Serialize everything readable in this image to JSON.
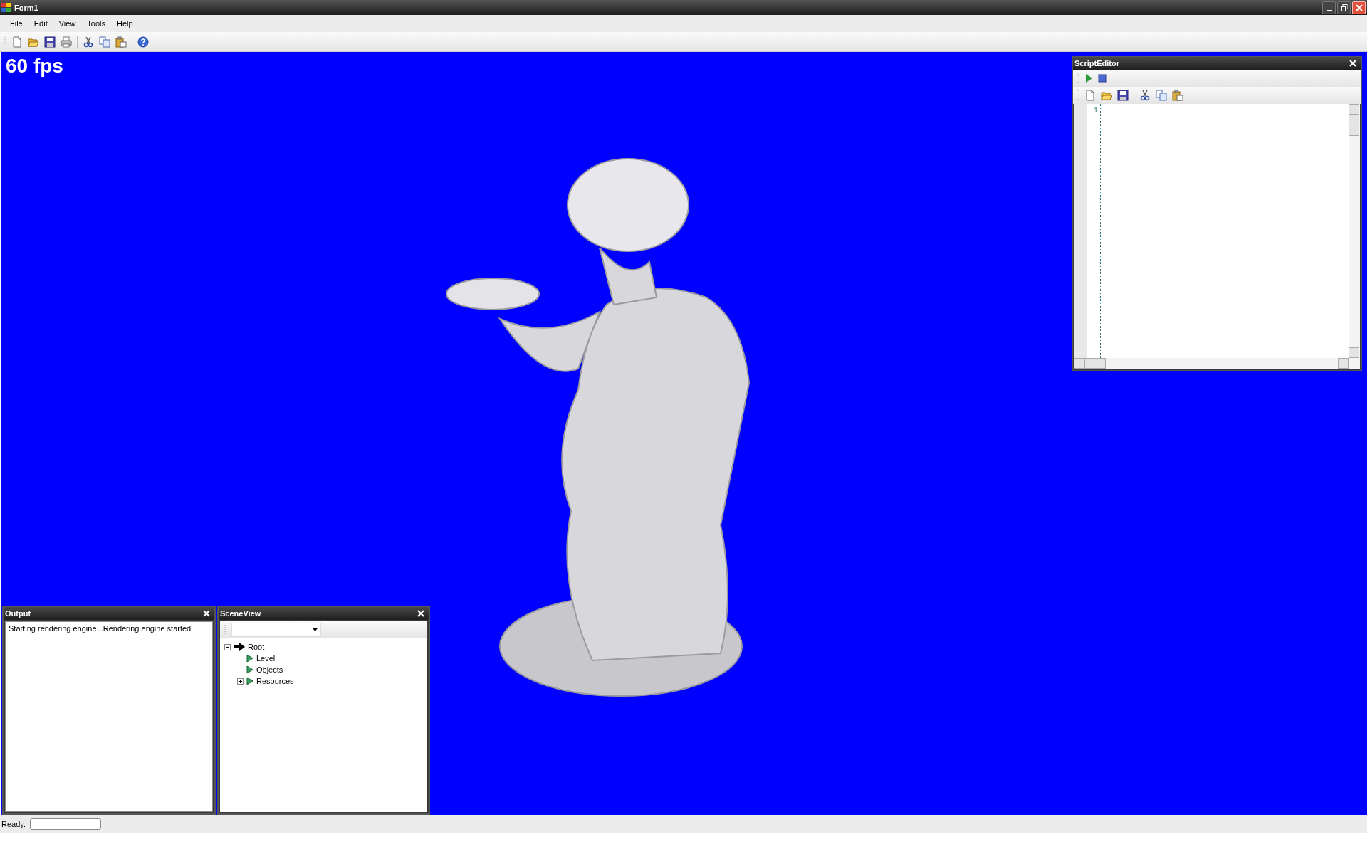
{
  "window": {
    "title": "Form1"
  },
  "menu": [
    "File",
    "Edit",
    "View",
    "Tools",
    "Help"
  ],
  "viewport": {
    "fps": "60 fps"
  },
  "script_editor": {
    "title": "ScriptEditor",
    "line_numbers": [
      "1"
    ]
  },
  "output": {
    "title": "Output",
    "text": "Starting rendering engine...Rendering engine started."
  },
  "scene_view": {
    "title": "SceneView",
    "tree": [
      {
        "label": "Root",
        "kind": "root",
        "has_children": true,
        "expanded": true,
        "children": [
          {
            "label": "Level",
            "kind": "node",
            "has_children": false,
            "expanded": false
          },
          {
            "label": "Objects",
            "kind": "node",
            "has_children": false,
            "expanded": false
          },
          {
            "label": "Resources",
            "kind": "node",
            "has_children": true,
            "expanded": false
          }
        ]
      }
    ]
  },
  "status_bar": {
    "text": "Ready.",
    "level": 0
  }
}
